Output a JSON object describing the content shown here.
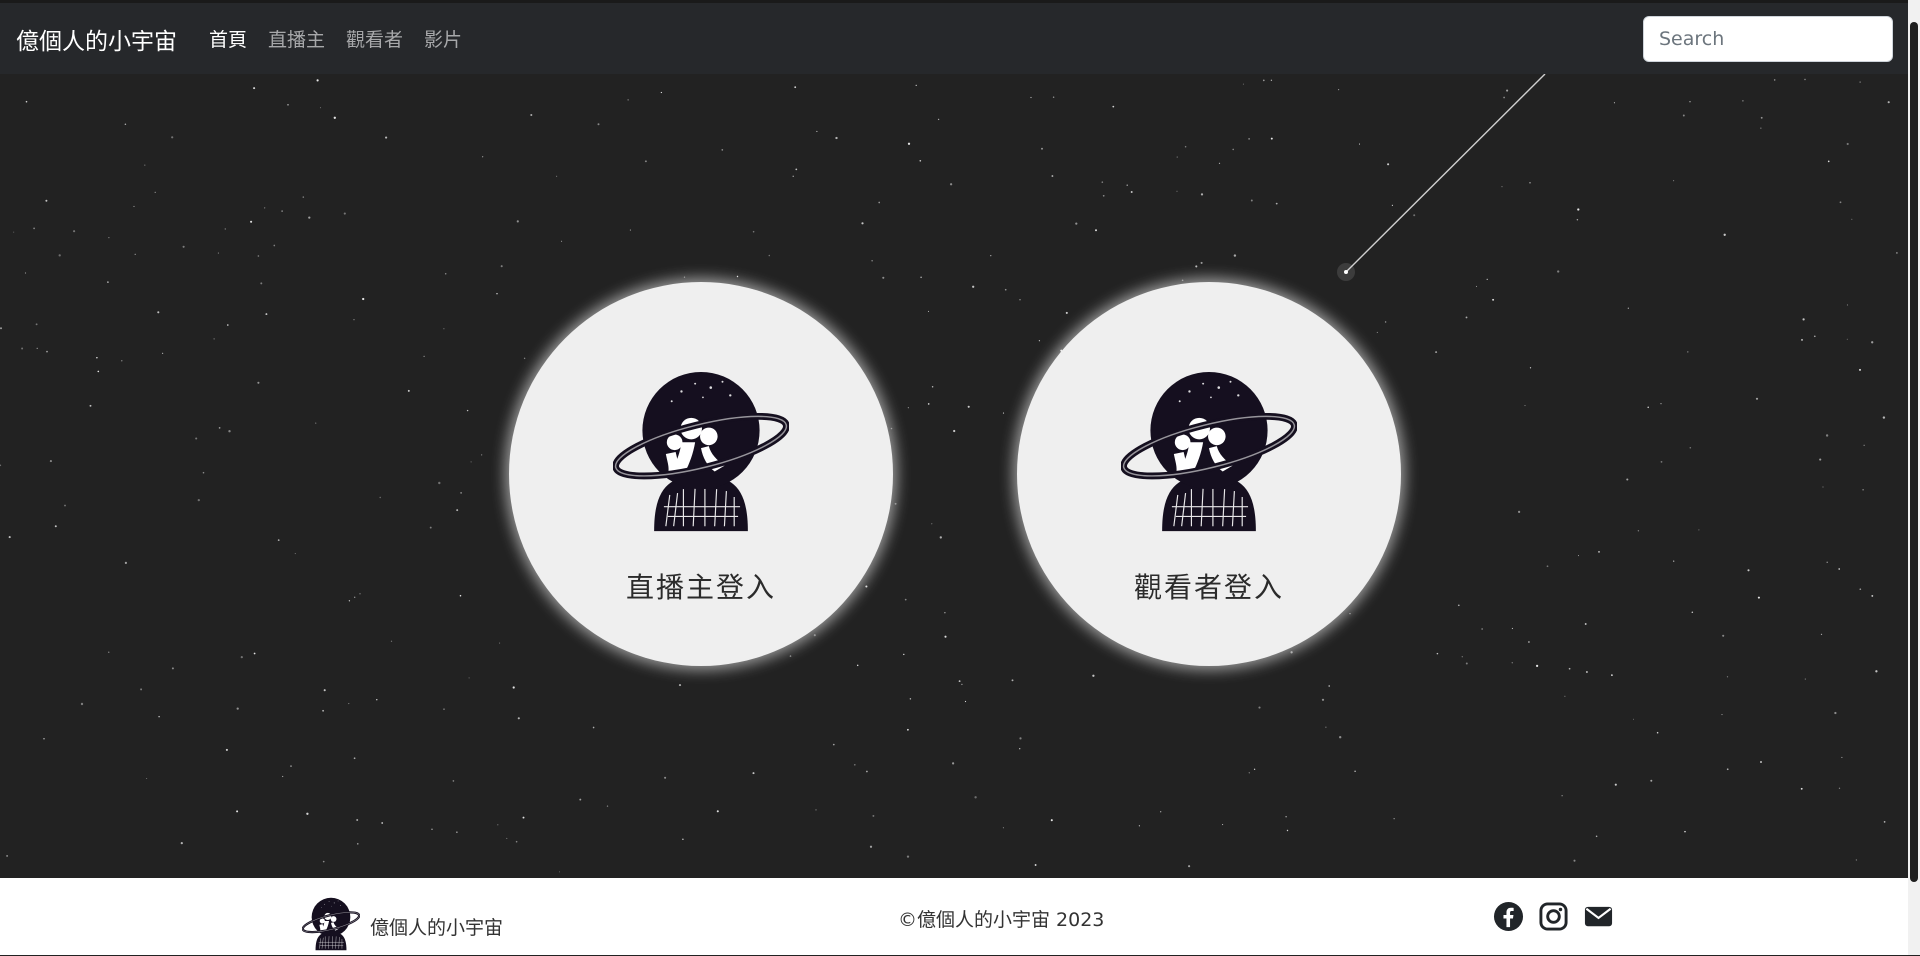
{
  "navbar": {
    "brand": "億個人的小宇宙",
    "links": [
      {
        "label": "首頁",
        "active": true
      },
      {
        "label": "直播主",
        "active": false
      },
      {
        "label": "觀看者",
        "active": false
      },
      {
        "label": "影片",
        "active": false
      }
    ],
    "search_placeholder": "Search"
  },
  "main": {
    "cards": [
      {
        "label": "直播主登入"
      },
      {
        "label": "觀看者登入"
      }
    ]
  },
  "footer": {
    "name": "億個人的小宇宙",
    "copyright": "©億個人的小宇宙 2023",
    "social_icons": [
      "facebook-icon",
      "instagram-icon",
      "envelope-icon"
    ]
  },
  "colors": {
    "background": "#222222",
    "navbar": "#26282b",
    "card": "#efefef",
    "logo": "#150f1f"
  }
}
